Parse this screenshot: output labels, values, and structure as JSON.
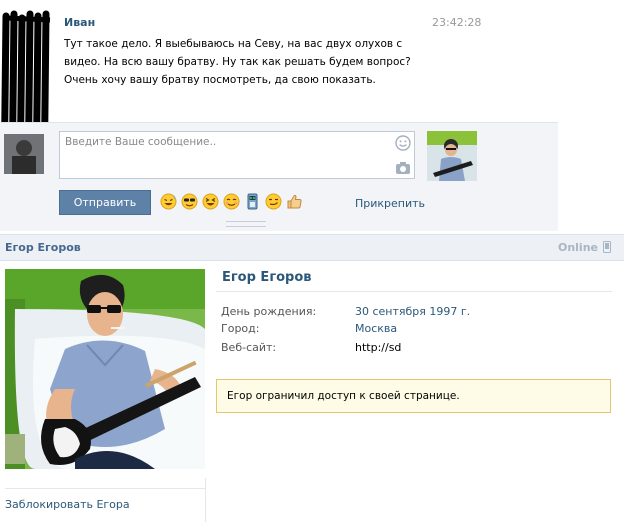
{
  "message": {
    "sender": "Иван",
    "time": "23:42:28",
    "lines": [
      "Тут такое дело. Я выебываюсь на Севу, на вас двух олухов с",
      "видео. На всю вашу братву. Ну так как решать будем вопрос?",
      "Очень хочу вашу братву посмотреть, да свою показать."
    ]
  },
  "compose": {
    "placeholder": "Введите Ваше сообщение..",
    "send_label": "Отправить",
    "attach_label": "Прикрепить",
    "emoji": [
      "laughing-sweat",
      "cool-sunglasses",
      "laughing-eyes",
      "blush",
      "robot",
      "smirk",
      "thumbs-up"
    ]
  },
  "profile": {
    "header_name": "Егор Егоров",
    "status": "Online",
    "name": "Егор Егоров",
    "fields": [
      {
        "label": "День рождения:",
        "value": "30 сентября 1997 г.",
        "link": true
      },
      {
        "label": "Город:",
        "value": "Москва",
        "link": true
      },
      {
        "label": "Веб-сайт:",
        "value": "http://sd",
        "link": false
      }
    ],
    "restricted_notice": "Егор ограничил доступ к своей странице.",
    "block_label": "Заблокировать Егора"
  },
  "colors": {
    "link": "#2b587a",
    "button": "#5e81a8",
    "header_bg": "#edf0f4",
    "compose_bg": "#f2f4f7",
    "notice_bg": "#fefbe6",
    "notice_border": "#e2c670"
  }
}
